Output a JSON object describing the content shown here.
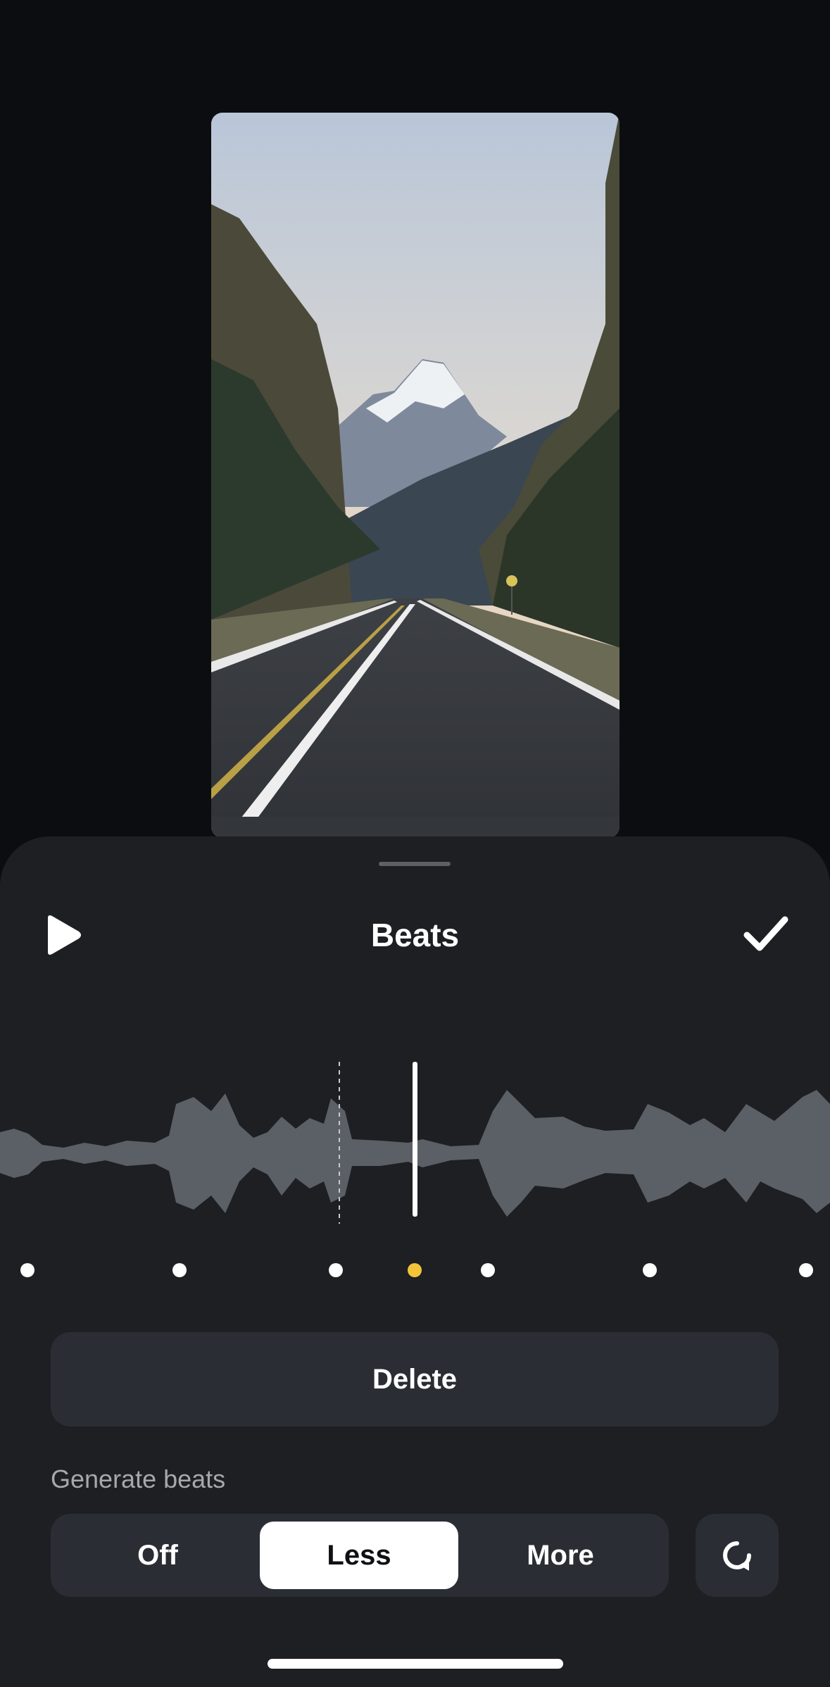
{
  "header": {
    "title": "Beats",
    "play_icon": "play-icon",
    "confirm_icon": "checkmark-icon"
  },
  "preview": {
    "collapse_icon": "chevron-down-icon"
  },
  "beats": {
    "count": 7,
    "selected_index": 3,
    "selected_color": "#f2c43a"
  },
  "actions": {
    "delete_label": "Delete"
  },
  "generate": {
    "label": "Generate beats",
    "options": [
      "Off",
      "Less",
      "More"
    ],
    "selected": "Less",
    "refresh_icon": "refresh-icon"
  },
  "colors": {
    "background": "#0b0d10",
    "sheet": "#1e1f23",
    "control": "#2a2d34",
    "waveform": "#5b5f66",
    "accent": "#f2c43a"
  }
}
